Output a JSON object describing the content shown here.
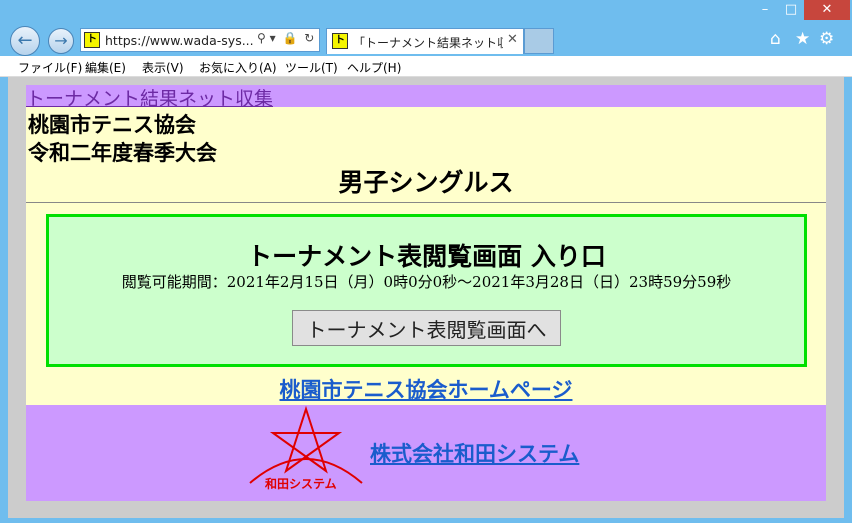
{
  "window": {
    "minimize_glyph": "–",
    "maximize_glyph": "□",
    "close_glyph": "✕"
  },
  "navbar": {
    "back_glyph": "←",
    "forward_glyph": "→",
    "favicon_text": "ト",
    "address": "https://www.wada-sys...",
    "address_tools": [
      "⚲ ▾",
      "🔒",
      "↻"
    ],
    "tab_title": "「トーナメント結果ネット収集」...",
    "tab_close": "✕",
    "home_icon": "home-icon",
    "home_glyph": "⌂",
    "favorites_glyph": "★",
    "settings_glyph": "⚙"
  },
  "menubar": {
    "items": [
      "ファイル(F)",
      "編集(E)",
      "表示(V)",
      "お気に入り(A)",
      "ツール(T)",
      "ヘルプ(H)"
    ]
  },
  "page": {
    "top_link": "トーナメント結果ネット収集",
    "organization": "桃園市テニス協会",
    "event": "令和二年度春季大会",
    "category": "男子シングルス",
    "entry": {
      "title": "トーナメント表閲覧画面 入り口",
      "period": "閲覧可能期間：2021年2月15日（月）0時0分0秒～2021年3月28日（日）23時59分59秒",
      "button_label": "トーナメント表閲覧画面へ"
    },
    "home_link": "桃園市テニス協会ホームページ",
    "footer": {
      "logo_text": "和田システム",
      "company_link": "株式会社和田システム"
    }
  },
  "colors": {
    "chrome": "#6fbdee",
    "page_bg": "#ffffcc",
    "link_bar": "#cc99ff",
    "entry_bg": "#ccffcc",
    "entry_border": "#00e000",
    "link": "#1a5ccc",
    "logo_red": "#e00000"
  }
}
